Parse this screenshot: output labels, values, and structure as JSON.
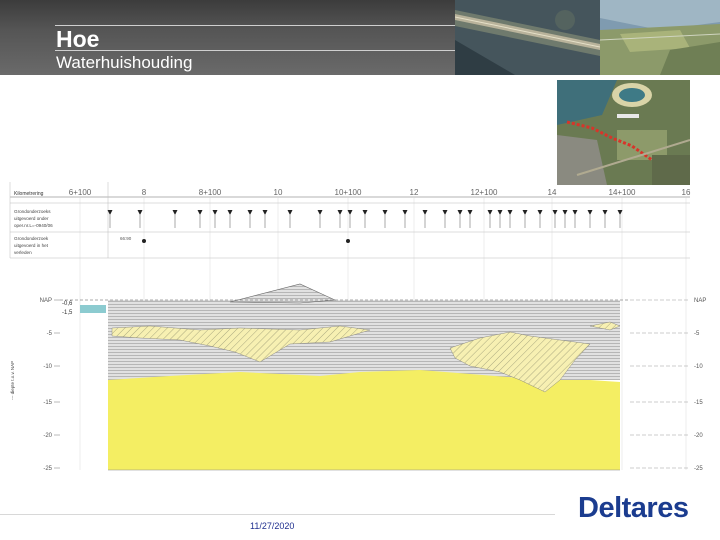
{
  "slide": {
    "title": "Hoe",
    "subtitle": "Waterhuishouding",
    "date": "11/27/2020",
    "logo_text": "Deltares"
  },
  "section": {
    "km_label": "Kilometrering",
    "km_ticks": [
      "6+100",
      "8",
      "8+100",
      "10",
      "10+100",
      "12",
      "12+100",
      "14",
      "14+100",
      "16"
    ],
    "legend_lines": [
      [
        "Grondonderzoeks",
        "uitgevoerd onder",
        "oper.nr.L=-0940/06"
      ],
      [
        "Grondonderzoek",
        "uitgevoerd in het",
        "verleden"
      ]
    ],
    "left_axis_label": "--- diepte t.o.v. NAP",
    "depth_ticks_left": [
      "NAP",
      "-5",
      "-10",
      "-15",
      "-20",
      "-25"
    ],
    "depth_ticks_right": [
      "NAP",
      "-5",
      "-10",
      "-15",
      "-20",
      "-25"
    ],
    "water_levels": [
      "-0,6",
      "-1,5"
    ],
    "sounding_code": "66:90",
    "colors": {
      "sand": "#f4ee63",
      "clay": "#d9d9d9",
      "peat_hatch": "#f5eea0",
      "water_bar": "#8ccbd0",
      "brand": "#1b3c8f"
    }
  },
  "icons": {
    "bridge_photo": "highway-bridge-photo",
    "coast_photo": "coastline-aerial-photo",
    "aerial_map": "aerial-location-map"
  }
}
